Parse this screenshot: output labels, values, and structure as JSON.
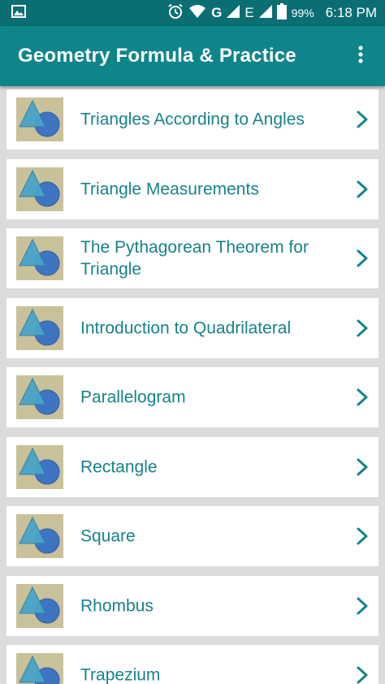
{
  "status_bar": {
    "battery": "99%",
    "time": "6:18 PM",
    "network_g": "G",
    "network_e": "E",
    "icons": [
      "image-icon",
      "alarm-icon",
      "wifi-icon",
      "signal-icon",
      "battery-icon"
    ]
  },
  "app_bar": {
    "title": "Geometry Formula & Practice",
    "overflow_icon": "more-vert-icon"
  },
  "colors": {
    "status_bar": "#0a6e73",
    "app_bar": "#0d858b",
    "item_text": "#16838b",
    "background": "#dcdcdc",
    "thumb_bg": "#c9c19a",
    "triangle": "#4aa3c9",
    "circle": "#3f74c2"
  },
  "topics": [
    {
      "label": "Triangles According to Angles",
      "icon": "triangle-circle-icon"
    },
    {
      "label": "Triangle Measurements",
      "icon": "triangle-circle-icon"
    },
    {
      "label": "The Pythagorean Theorem for Triangle",
      "icon": "triangle-circle-icon"
    },
    {
      "label": "Introduction to Quadrilateral",
      "icon": "triangle-circle-icon"
    },
    {
      "label": "Parallelogram",
      "icon": "triangle-circle-icon"
    },
    {
      "label": "Rectangle",
      "icon": "triangle-circle-icon"
    },
    {
      "label": "Square",
      "icon": "triangle-circle-icon"
    },
    {
      "label": "Rhombus",
      "icon": "triangle-circle-icon"
    },
    {
      "label": "Trapezium",
      "icon": "triangle-circle-icon"
    }
  ]
}
